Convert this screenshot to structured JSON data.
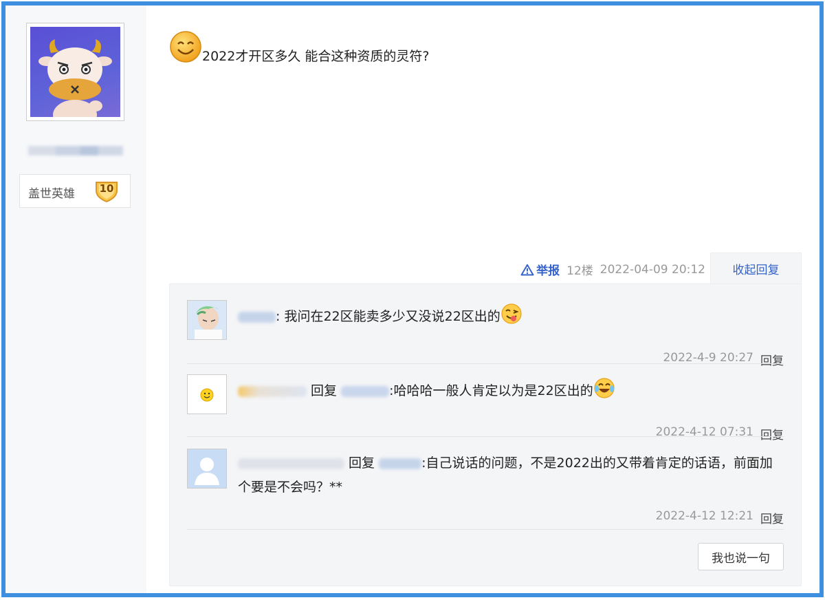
{
  "author": {
    "avatar_icon": "cow-avatar-icon",
    "level_title": "盖世英雄",
    "level_number": "10"
  },
  "post": {
    "content": "2022才开区多久 能合这种资质的灵符?",
    "report_label": "举报",
    "floor": "12楼",
    "datetime": "2022-04-09 20:12",
    "collapse_label": "收起回复"
  },
  "replies": [
    {
      "text": ": 我问在22区能卖多少又没说22区出的",
      "time": "2022-4-9 20:27",
      "reply_label": "回复"
    },
    {
      "reply_word": "回复",
      "text": ":哈哈哈一般人肯定以为是22区出的",
      "time": "2022-4-12 07:31",
      "reply_label": "回复"
    },
    {
      "reply_word": "回复",
      "text": ":自己说话的问题，不是2022出的又带着肯定的话语，前面加个要是不会吗？**",
      "time": "2022-4-12 12:21",
      "reply_label": "回复"
    }
  ],
  "say_button": "我也说一句",
  "colors": {
    "frame": "#3f8fe0",
    "link": "#3563c9",
    "panel": "#f4f5f7"
  }
}
